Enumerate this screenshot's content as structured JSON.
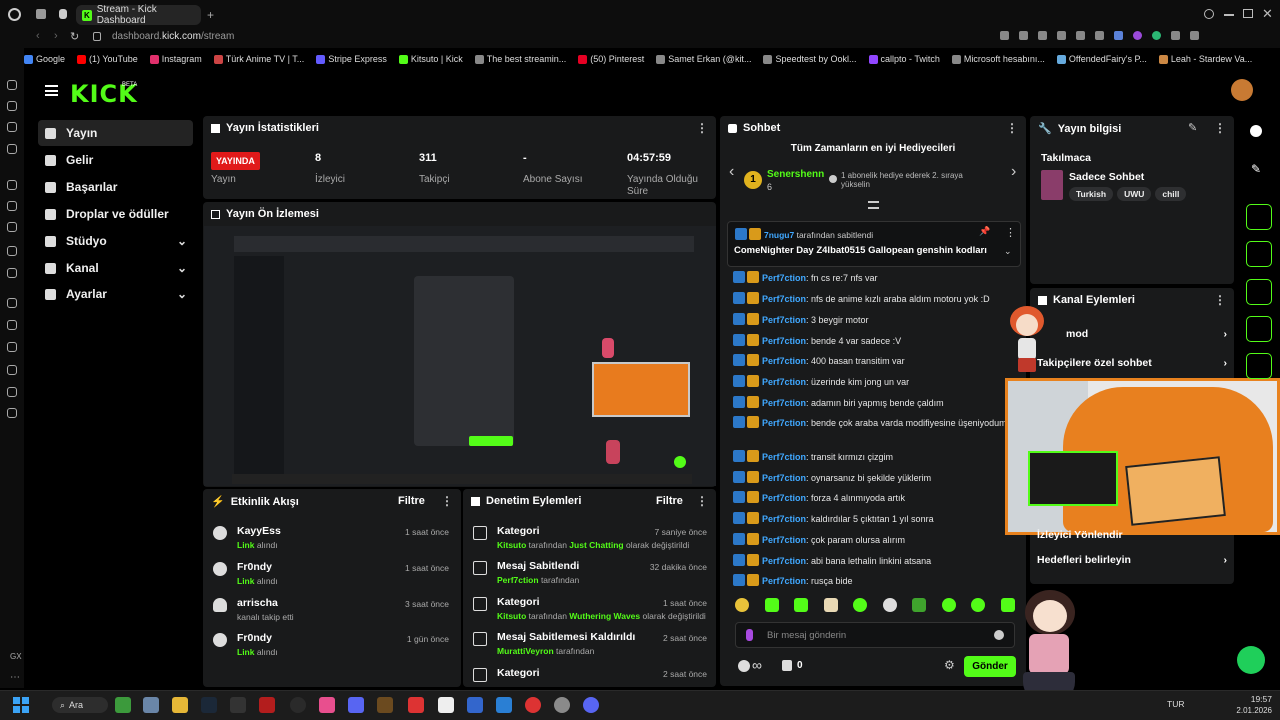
{
  "browser": {
    "tab_title": "Stream - Kick Dashboard",
    "url_prefix": "dashboard.",
    "url_domain": "kick.com",
    "url_path": "/stream",
    "bookmarks": [
      "Google",
      "(1) YouTube",
      "Instagram",
      "Türk Anime TV | T...",
      "Stripe Express",
      "Kitsuto | Kick",
      "The best streamin...",
      "(50) Pinterest",
      "Samet Erkan (@kit...",
      "Speedtest by Ookl...",
      "callpto - Twitch",
      "Microsoft hesabını...",
      "OffendedFairy's P...",
      "Leah - Stardew Va..."
    ]
  },
  "brand": {
    "logo": "KICK",
    "beta": "BETA",
    "accent": "#53fc18"
  },
  "sidebar": {
    "items": [
      {
        "label": "Yayın",
        "icon": "broadcast-icon",
        "active": true
      },
      {
        "label": "Gelir",
        "icon": "revenue-icon"
      },
      {
        "label": "Başarılar",
        "icon": "trophy-icon"
      },
      {
        "label": "Droplar ve ödüller",
        "icon": "gift-icon"
      },
      {
        "label": "Stüdyo",
        "icon": "studio-icon",
        "expandable": true
      },
      {
        "label": "Kanal",
        "icon": "channel-icon",
        "expandable": true
      },
      {
        "label": "Ayarlar",
        "icon": "gear-icon",
        "expandable": true
      }
    ]
  },
  "stats": {
    "title": "Yayın İstatistikleri",
    "live_badge": "YAYINDA",
    "items": [
      {
        "value": "",
        "label": "Yayın"
      },
      {
        "value": "8",
        "label": "İzleyici"
      },
      {
        "value": "311",
        "label": "Takipçi"
      },
      {
        "value": "-",
        "label": "Abone Sayısı"
      },
      {
        "value": "04:57:59",
        "label": "Yayında Olduğu Süre"
      }
    ]
  },
  "preview": {
    "title": "Yayın Ön İzlemesi"
  },
  "activity": {
    "title": "Etkinlik Akışı",
    "filter": "Filtre",
    "items": [
      {
        "name": "KayyEss",
        "sub_link": "Link",
        "sub_rest": " alındı",
        "time": "1 saat önce"
      },
      {
        "name": "Fr0ndy",
        "sub_link": "Link",
        "sub_rest": " alındı",
        "time": "1 saat önce"
      },
      {
        "name": "arrischa",
        "sub_link": "",
        "sub_rest": "kanalı takip etti",
        "time": "3 saat önce"
      },
      {
        "name": "Fr0ndy",
        "sub_link": "Link",
        "sub_rest": " alındı",
        "time": "1 gün önce"
      }
    ]
  },
  "moderation": {
    "title": "Denetim Eylemleri",
    "filter": "Filtre",
    "items": [
      {
        "title": "Kategori",
        "sub_user": "Kitsuto",
        "sub_mid": " tarafından ",
        "sub_target": "Just Chatting",
        "sub_end": " olarak değiştirildi",
        "time": "7 saniye önce"
      },
      {
        "title": "Mesaj Sabitlendi",
        "sub_user": "Perf7ction",
        "sub_mid": " tarafından",
        "sub_target": "",
        "sub_end": "",
        "time": "32 dakika önce"
      },
      {
        "title": "Kategori",
        "sub_user": "Kitsuto",
        "sub_mid": " tarafından ",
        "sub_target": "Wuthering Waves",
        "sub_end": " olarak değiştirildi",
        "time": "1 saat önce"
      },
      {
        "title": "Mesaj Sabitlemesi Kaldırıldı",
        "sub_user": "MurattiVeyron",
        "sub_mid": " tarafından",
        "sub_target": "",
        "sub_end": "",
        "time": "2 saat önce"
      },
      {
        "title": "Kategori",
        "sub_user": "",
        "sub_mid": "",
        "sub_target": "",
        "sub_end": "",
        "time": "2 saat önce"
      }
    ]
  },
  "chat": {
    "title": "Sohbet",
    "top_gifters_title": "Tüm Zamanların en iyi Hediyecileri",
    "top_gifter": {
      "rank": "1",
      "name": "Senershenn",
      "count": "6"
    },
    "gift_note": "1 abonelik hediye ederek 2. sıraya yükselin",
    "pinned_by_user": "7nugu7",
    "pinned_by_text": " tarafından sabitlendi",
    "pinned_message": "ComeNighter Day Z4lbat0515 Gallopean genshin kodları",
    "messages": [
      {
        "user": "Perf7ction",
        "text": ": fn cs re:7 nfs var"
      },
      {
        "user": "Perf7ction",
        "text": ": nfs de anime kızlı araba aldım motoru yok :D"
      },
      {
        "user": "Perf7ction",
        "text": ": 3 beygir motor"
      },
      {
        "user": "Perf7ction",
        "text": ": bende 4 var sadece :V"
      },
      {
        "user": "Perf7ction",
        "text": ": 400 basan transitim var"
      },
      {
        "user": "Perf7ction",
        "text": ": üzerinde kim jong un var"
      },
      {
        "user": "Perf7ction",
        "text": ": adamın biri yapmış bende çaldım"
      },
      {
        "user": "Perf7ction",
        "text": ": bende çok araba varda modifiyesine üşeniyodum"
      },
      {
        "user": "Perf7ction",
        "text": ": transit kırmızı çizgim"
      },
      {
        "user": "Perf7ction",
        "text": ": oynarsanız bi şekilde yüklerim"
      },
      {
        "user": "Perf7ction",
        "text": ": forza 4 alınmıyoda artık"
      },
      {
        "user": "Perf7ction",
        "text": ": kaldırdılar 5 çıktıtan 1 yıl sonra"
      },
      {
        "user": "Perf7ction",
        "text": ": çok param olursa alırım"
      },
      {
        "user": "Perf7ction",
        "text": ": abi bana lethalin linkini atsana"
      },
      {
        "user": "Perf7ction",
        "text": ": rusça bide"
      }
    ],
    "input_placeholder": "Bir mesaj gönderin",
    "infinity": "∞",
    "count": "0",
    "send_label": "Gönder"
  },
  "stream_info": {
    "title": "Yayın bilgisi",
    "subtitle": "Takılmaca",
    "stream_title": "Sadece Sohbet",
    "tags": [
      "Turkish",
      "UWU",
      "chill"
    ]
  },
  "channel_actions": {
    "title": "Kanal Eylemleri",
    "items": [
      "mod",
      "Takipçilere özel sohbet",
      "İzleyici Yönlendir",
      "Hedefleri belirleyin"
    ]
  },
  "taskbar": {
    "search": "Ara",
    "lang": "TUR",
    "time": "19:57",
    "date": "2.01.2026"
  },
  "status_gx": "GX"
}
